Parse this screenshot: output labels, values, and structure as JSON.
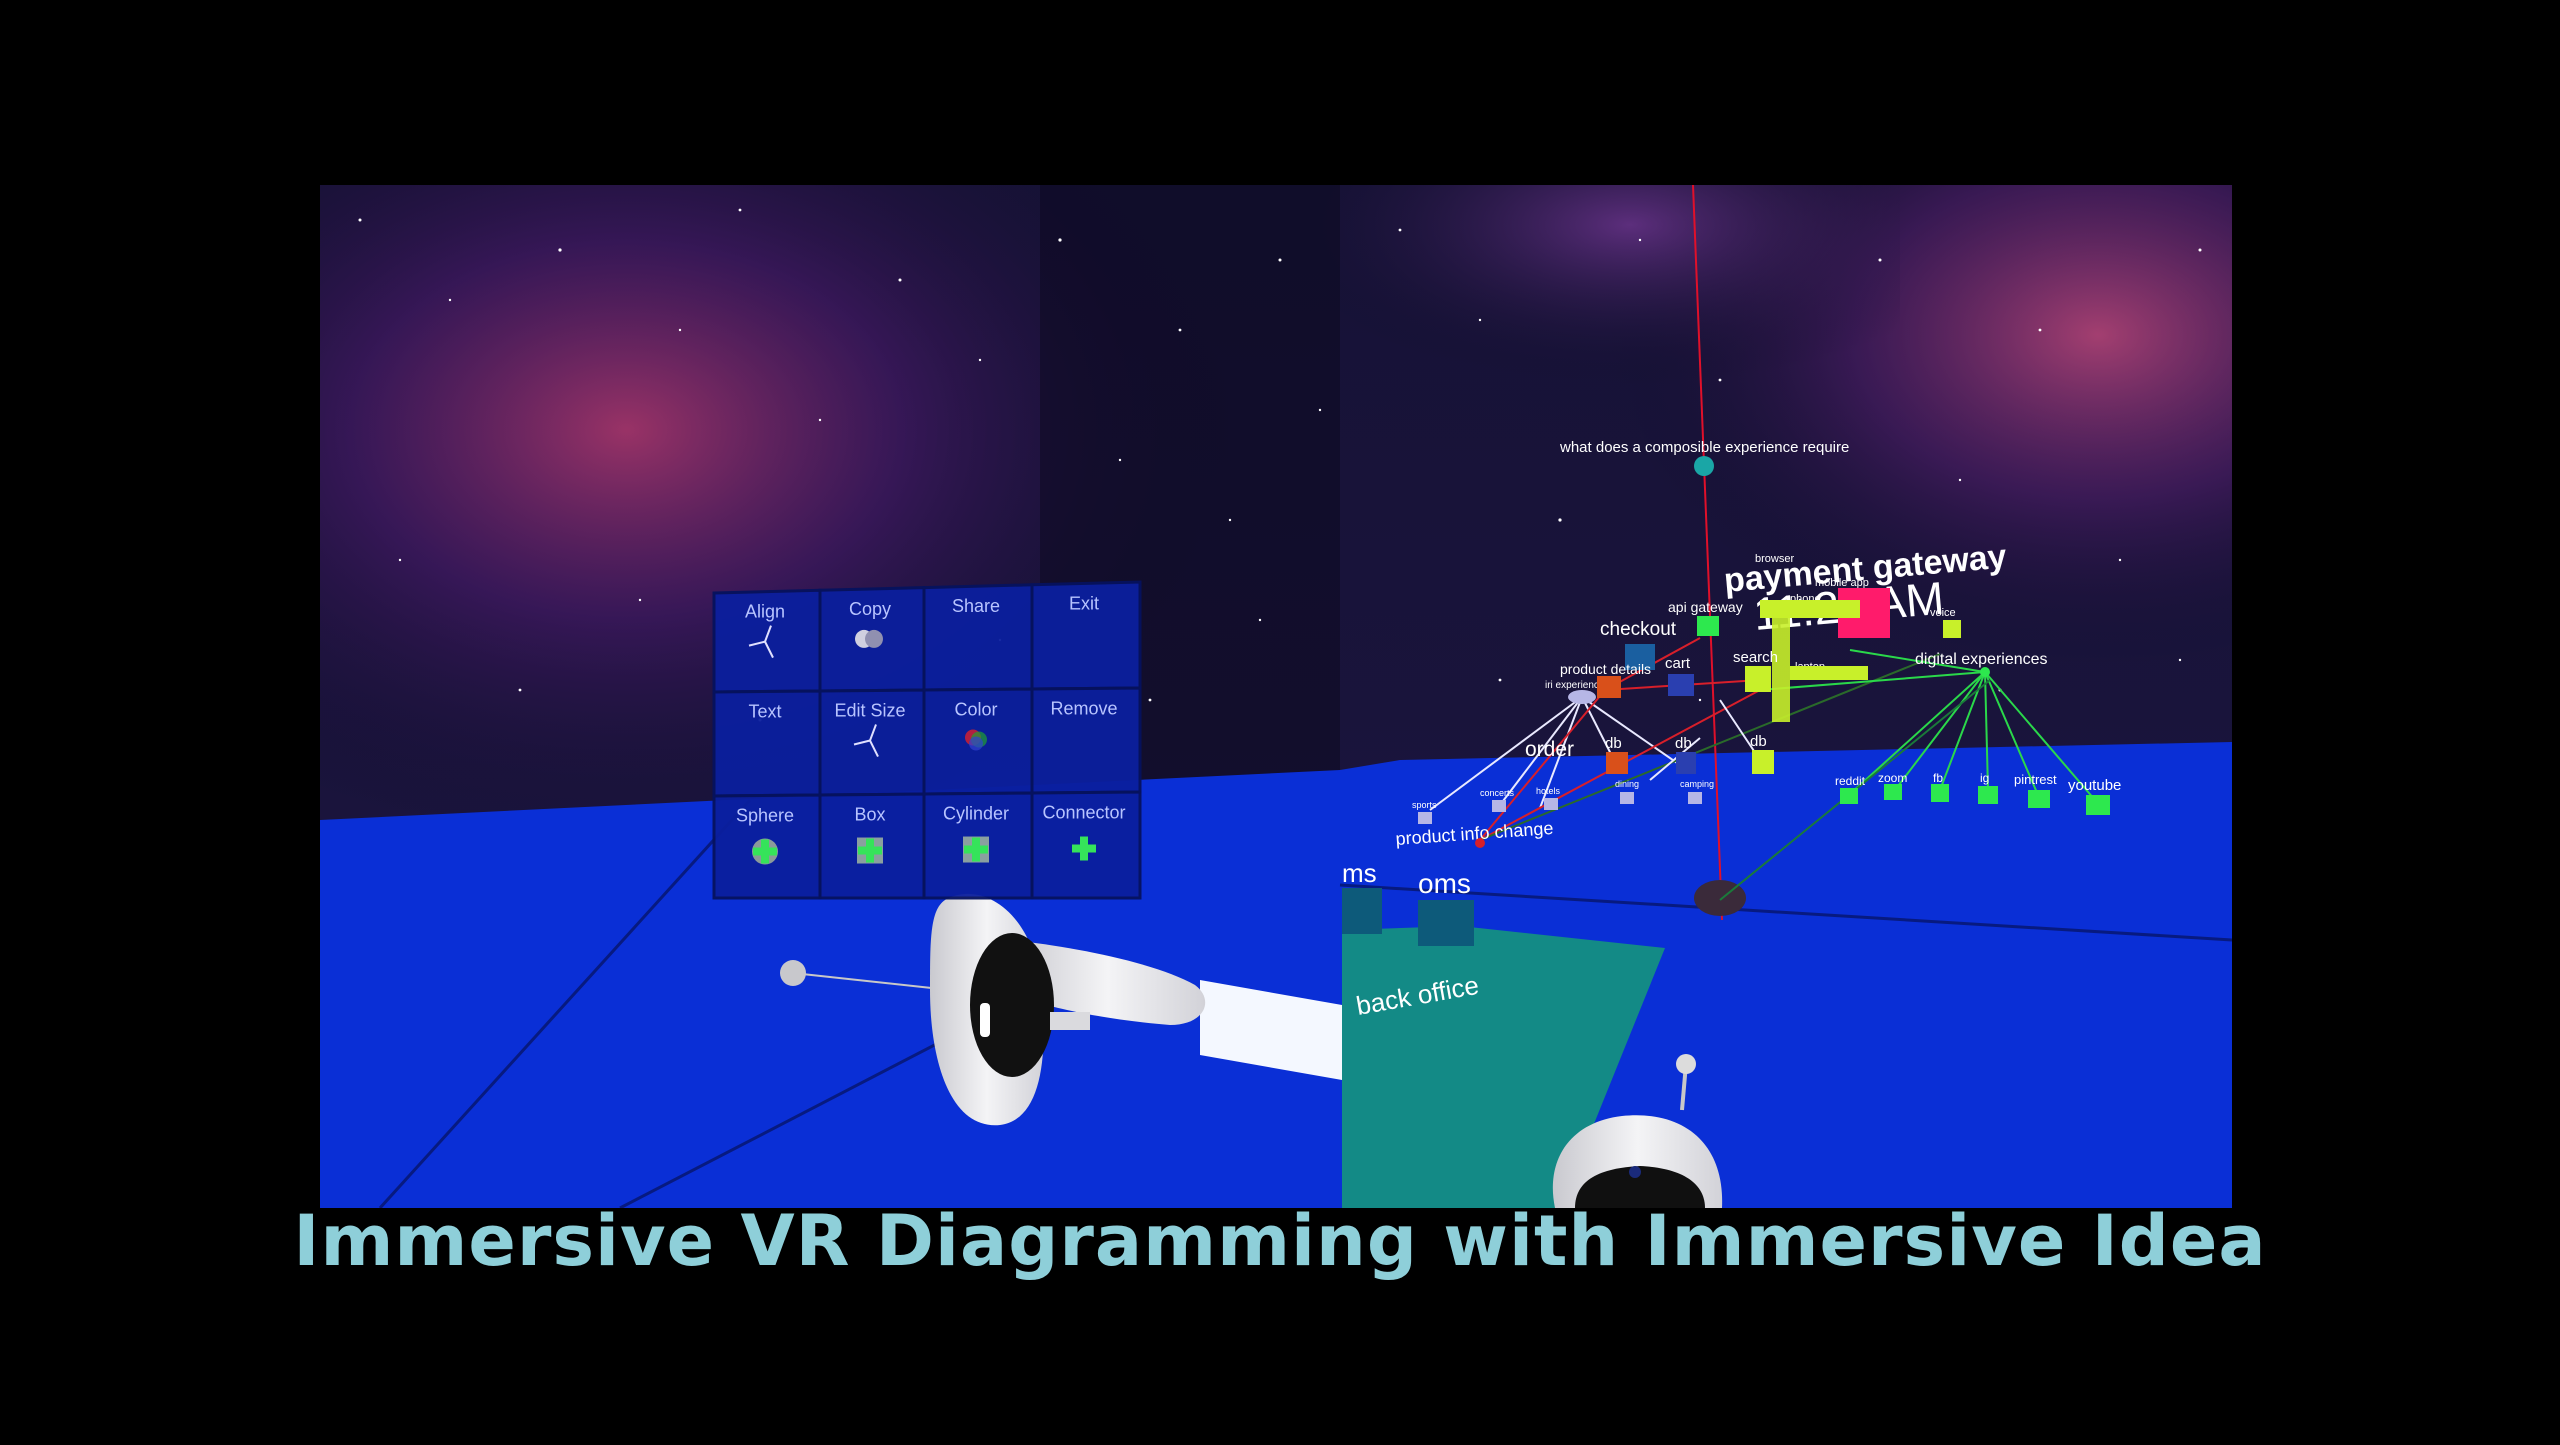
{
  "caption": "Immersive VR Diagramming with Immersive Idea",
  "colors": {
    "caption": "#8ecfd9",
    "floor": "#0a2fd6",
    "panel": "#0b1f9e",
    "plus": "#35e35a",
    "teal": "#138a86",
    "node_green": "#2de84e",
    "node_lime": "#c8f02a",
    "node_pink": "#ff1b6b",
    "node_orange": "#d9501a"
  },
  "menu_panel": {
    "rows": [
      [
        {
          "label": "Align",
          "icon": "align-axes-icon"
        },
        {
          "label": "Copy",
          "icon": "copy-circles-icon"
        },
        {
          "label": "Share",
          "icon": ""
        },
        {
          "label": "Exit",
          "icon": ""
        }
      ],
      [
        {
          "label": "Text",
          "icon": ""
        },
        {
          "label": "Edit Size",
          "icon": "resize-axes-icon"
        },
        {
          "label": "Color",
          "icon": "color-wheel-icon"
        },
        {
          "label": "Remove",
          "icon": ""
        }
      ],
      [
        {
          "label": "Sphere",
          "icon": "plus-icon"
        },
        {
          "label": "Box",
          "icon": "plus-icon"
        },
        {
          "label": "Cylinder",
          "icon": "plus-icon"
        },
        {
          "label": "Connector",
          "icon": "plus-icon"
        }
      ]
    ]
  },
  "diagram": {
    "question": "what does a composible experience require",
    "payment_gateway": "payment gateway",
    "clock": "11:23 AM",
    "browser": "browser",
    "mobile_app": "mobile app",
    "phone": "phone",
    "voice": "voice",
    "laptop": "laptop",
    "checkout": "checkout",
    "api_gateway": "api gateway",
    "cart": "cart",
    "search": "search",
    "product_details": "product details",
    "product_details_sub": "iri experiences",
    "order": "order",
    "db_1": "db",
    "db_2": "db",
    "db_3": "db",
    "dining": "dining",
    "camping": "camping",
    "concerts": "concerts",
    "hotels": "hotels",
    "sports": "sports",
    "product_info_change": "product info change",
    "digital_experiences": "digital experiences",
    "reddit": "reddit",
    "zoom": "zoom",
    "fb": "fb",
    "ig": "ig",
    "pintrest": "pintrest",
    "youtube": "youtube",
    "ms": "ms",
    "oms": "oms",
    "back_office": "back office"
  }
}
